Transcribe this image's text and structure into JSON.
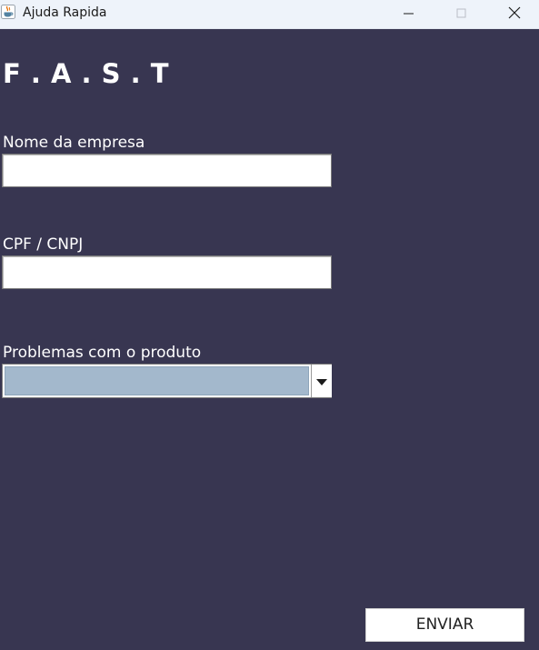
{
  "window": {
    "title": "Ajuda Rapida",
    "app_icon": "java-coffee-cup-icon",
    "controls": {
      "minimize_icon": "minimize-icon",
      "maximize_icon": "maximize-icon",
      "close_icon": "close-icon"
    }
  },
  "form": {
    "heading": "F . A . S . T",
    "company": {
      "label": "Nome da empresa",
      "value": "",
      "placeholder": ""
    },
    "tax_id": {
      "label": "CPF / CNPJ",
      "value": "",
      "placeholder": ""
    },
    "problem": {
      "label": "Problemas com o produto",
      "selected": "",
      "arrow_icon": "triangle-down-icon"
    },
    "submit_label": "ENVIAR"
  },
  "colors": {
    "background": "#383651",
    "titlebar": "#eef3fa",
    "combo_selection": "#a3b8cc",
    "text_on_dark": "#ffffff"
  }
}
